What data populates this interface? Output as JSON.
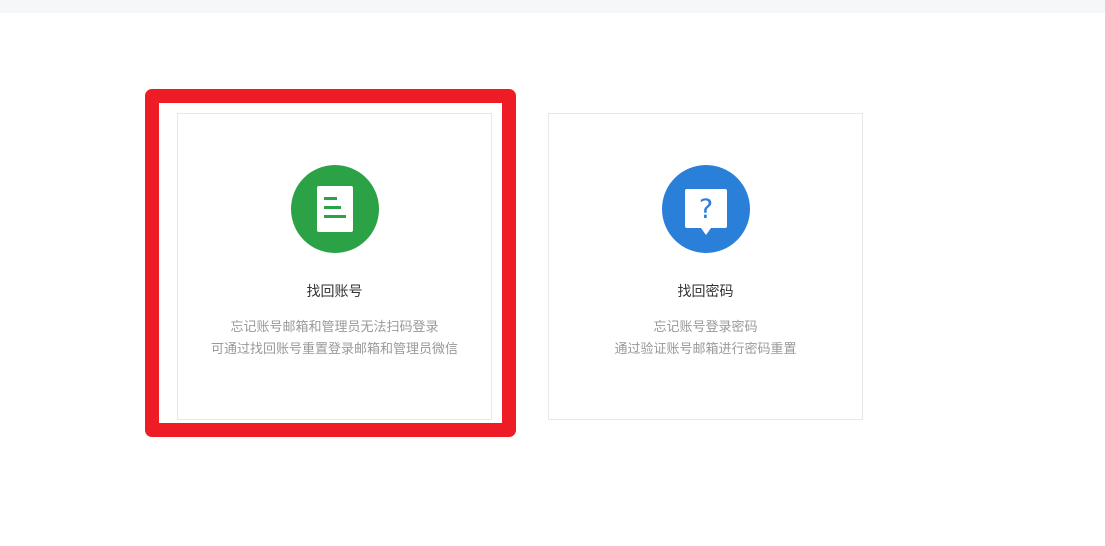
{
  "colors": {
    "account_icon_bg": "#2ba245",
    "password_icon_bg": "#2a80d9",
    "highlight": "#ee1c25",
    "title_text": "#333333",
    "desc_text": "#999999"
  },
  "cards": [
    {
      "id": "recover-account",
      "icon": "document-list-icon",
      "title": "找回账号",
      "desc_lines": [
        "忘记账号邮箱和管理员无法扫码登录",
        "可通过找回账号重置登录邮箱和管理员微信"
      ],
      "highlighted": true
    },
    {
      "id": "recover-password",
      "icon": "question-bubble-icon",
      "title": "找回密码",
      "desc_lines": [
        "忘记账号登录密码",
        "通过验证账号邮箱进行密码重置"
      ],
      "highlighted": false
    }
  ]
}
